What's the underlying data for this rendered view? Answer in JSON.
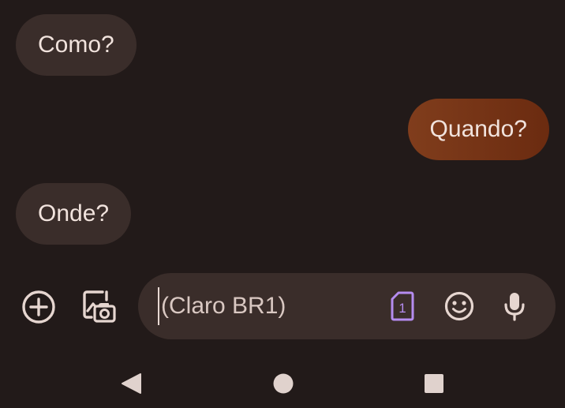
{
  "messages": [
    {
      "direction": "incoming",
      "text": "Como?"
    },
    {
      "direction": "outgoing",
      "text": "Quando?"
    },
    {
      "direction": "incoming",
      "text": "Onde?"
    }
  ],
  "compose": {
    "placeholder": "(Claro BR1)",
    "sim_slot": "1"
  },
  "icons": {
    "add": "add-circle-icon",
    "gallery": "gallery-camera-icon",
    "sim": "sim-card-icon",
    "emoji": "emoji-icon",
    "mic": "microphone-icon",
    "back": "nav-back-icon",
    "home": "nav-home-icon",
    "recents": "nav-recents-icon"
  },
  "colors": {
    "background": "#221a19",
    "incoming_bubble": "#3a2d2a",
    "outgoing_bubble": "#7a3516",
    "sim_accent": "#b58cf0",
    "icon": "#e6d6d0"
  }
}
